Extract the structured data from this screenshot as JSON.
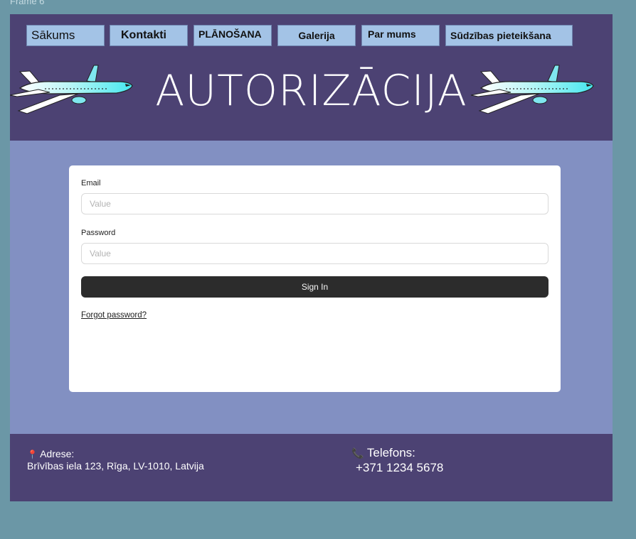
{
  "frame": {
    "label": "Frame 6"
  },
  "nav": {
    "items": [
      {
        "label": "Sākums"
      },
      {
        "label": "Kontakti"
      },
      {
        "label": "PLĀNOŠANA"
      },
      {
        "label": "Galerija"
      },
      {
        "label": "Par mums"
      },
      {
        "label": "Sūdzības pieteikšana"
      }
    ]
  },
  "header": {
    "title": "AUTORIZĀCIJA",
    "left_icon": "airplane-icon",
    "right_icon": "airplane-icon"
  },
  "form": {
    "email": {
      "label": "Email",
      "placeholder": "Value"
    },
    "password": {
      "label": "Password",
      "placeholder": "Value"
    },
    "submit_label": "Sign In",
    "forgot_label": "Forgot password?"
  },
  "footer": {
    "address": {
      "icon": "map-pin-icon",
      "label": "Adrese:",
      "value": "Brīvības iela 123, Rīga, LV-1010, Latvija"
    },
    "phone": {
      "icon": "phone-icon",
      "label": "Telefons:",
      "value": "+371 1234 5678"
    }
  },
  "colors": {
    "page_bg": "#6b97a6",
    "header_bg": "#4c4273",
    "content_bg": "#8290c2",
    "nav_button_bg": "#a3c3e6",
    "signin_bg": "#2c2c2c"
  }
}
